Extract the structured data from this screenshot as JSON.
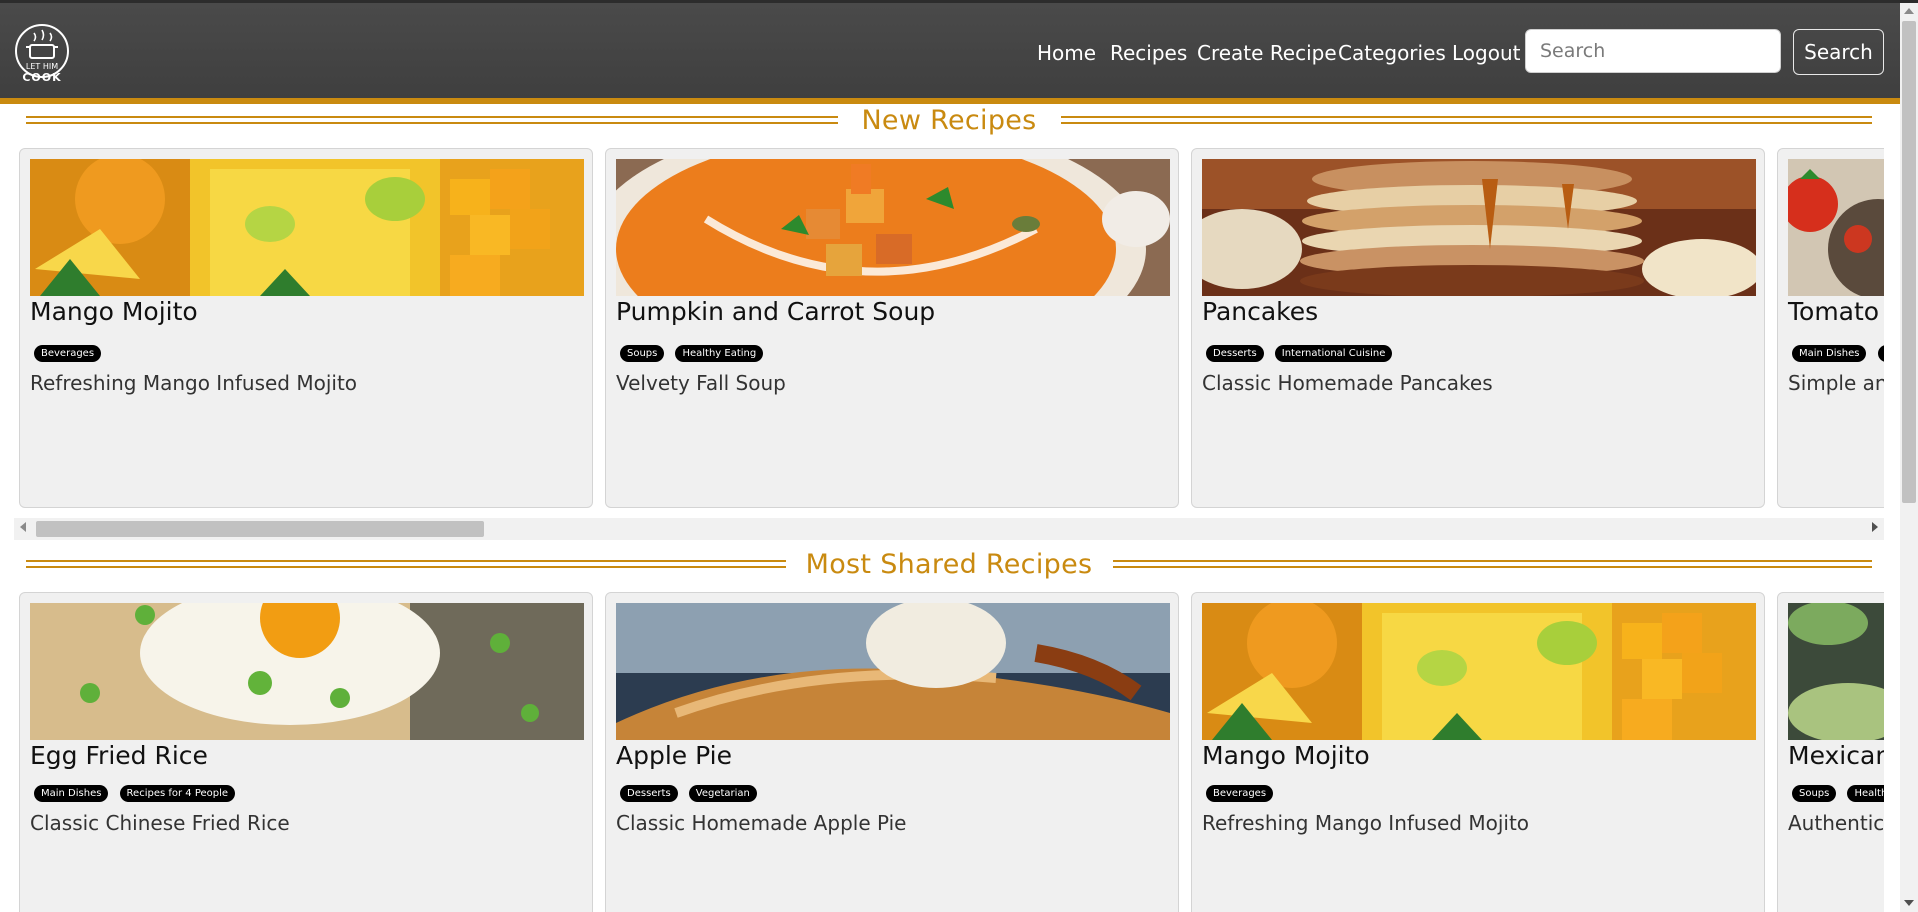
{
  "brand": {
    "logo_text_line1": "LET HIM",
    "logo_text_line2": "COOK"
  },
  "nav": {
    "items": [
      {
        "label": "Home"
      },
      {
        "label": "Recipes"
      },
      {
        "label": "Create Recipe"
      },
      {
        "label": "Categories"
      },
      {
        "label": "Logout"
      }
    ],
    "search_placeholder": "Search",
    "search_value": "",
    "search_button_label": "Search"
  },
  "sections": [
    {
      "title": "New Recipes",
      "cards": [
        {
          "title": "Mango Mojito",
          "badges": [
            "Beverages"
          ],
          "description": "Refreshing Mango Infused Mojito",
          "image": "mango-mojito"
        },
        {
          "title": "Pumpkin and Carrot Soup",
          "badges": [
            "Soups",
            "Healthy Eating"
          ],
          "description": "Velvety Fall Soup",
          "image": "pumpkin-soup"
        },
        {
          "title": "Pancakes",
          "badges": [
            "Desserts",
            "International Cuisine"
          ],
          "description": "Classic Homemade Pancakes",
          "image": "pancakes"
        },
        {
          "title": "Tomato a",
          "badges": [
            "Main Dishes",
            "F"
          ],
          "description": "Simple and",
          "image": "tomato"
        }
      ]
    },
    {
      "title": "Most Shared Recipes",
      "cards": [
        {
          "title": "Egg Fried Rice",
          "badges": [
            "Main Dishes",
            "Recipes for 4 People"
          ],
          "description": "Classic Chinese Fried Rice",
          "image": "egg-fried-rice"
        },
        {
          "title": "Apple Pie",
          "badges": [
            "Desserts",
            "Vegetarian"
          ],
          "description": "Classic Homemade Apple Pie",
          "image": "apple-pie"
        },
        {
          "title": "Mango Mojito",
          "badges": [
            "Beverages"
          ],
          "description": "Refreshing Mango Infused Mojito",
          "image": "mango-mojito"
        },
        {
          "title": "Mexican",
          "badges": [
            "Soups",
            "Health"
          ],
          "description": "Authentic M",
          "image": "mexican"
        }
      ]
    }
  ],
  "colors": {
    "accent": "#c98a10",
    "navbar": "#444444",
    "card_bg": "#f0f0f0",
    "badge_bg": "#000000"
  }
}
